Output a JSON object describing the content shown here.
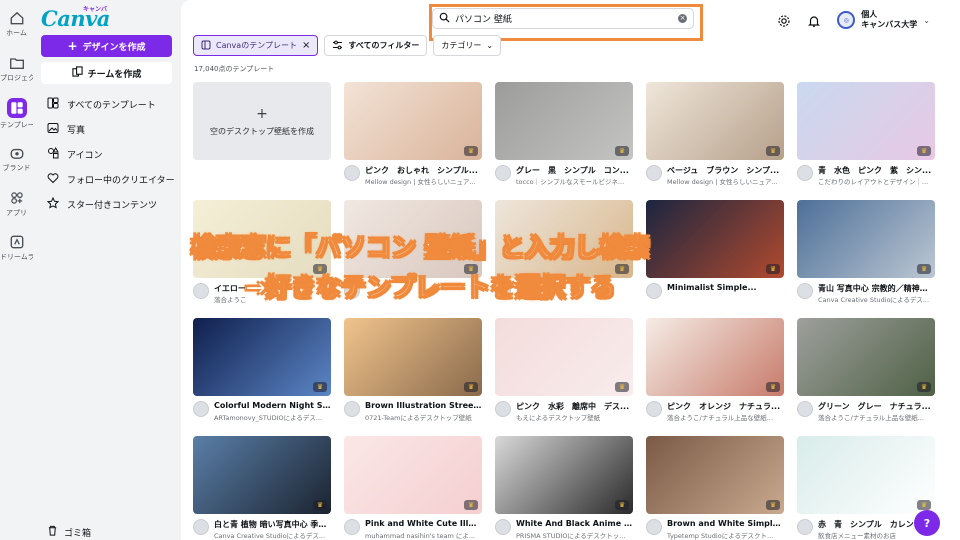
{
  "rail": [
    {
      "label": "ホーム",
      "icon": "home-icon"
    },
    {
      "label": "プロジェクト",
      "icon": "folder-icon"
    },
    {
      "label": "テンプレート",
      "icon": "templates-icon",
      "active": true
    },
    {
      "label": "ブランド",
      "icon": "brand-icon"
    },
    {
      "label": "アプリ",
      "icon": "apps-icon"
    },
    {
      "label": "ドリームラボ",
      "icon": "dreamlab-icon"
    }
  ],
  "logo": {
    "text": "Canva",
    "kana": "キャンバ"
  },
  "panel": {
    "create_label": "デザインを作成",
    "team_label": "チームを作成",
    "menu": [
      {
        "label": "すべてのテンプレート",
        "icon": "grid-icon"
      },
      {
        "label": "写真",
        "icon": "photo-icon"
      },
      {
        "label": "アイコン",
        "icon": "shapes-icon"
      },
      {
        "label": "フォロー中のクリエイター",
        "icon": "heart-icon"
      },
      {
        "label": "スター付きコンテンツ",
        "icon": "star-icon"
      }
    ],
    "trash_label": "ゴミ箱"
  },
  "search": {
    "value": "パソコン 壁紙"
  },
  "account": {
    "line1": "個人",
    "line2": "キャンバス大学"
  },
  "filters": {
    "selected_chip": "Canvaのテンプレート",
    "all_filters": "すべてのフィルター",
    "category": "カテゴリー"
  },
  "count_text": "17,040点のテンプレート",
  "blank_card": {
    "label": "空のデスクトップ壁紙を作成"
  },
  "cards": [
    {
      "title": "ピンク　おしゃれ　シンプル...",
      "sub": "Mellow design | 女性らしいニュア...",
      "colors": [
        "#f3e3d6",
        "#d9b39a"
      ]
    },
    {
      "title": "グレー　黒　シンプル　コン...",
      "sub": "tocco｜シンプルなスモールビジネ...",
      "colors": [
        "#9c9c9a",
        "#c4c4c2"
      ]
    },
    {
      "title": "ベージュ　ブラウン　シンプ...",
      "sub": "Mellow design | 女性らしいニュア...",
      "colors": [
        "#efe6da",
        "#b6a08a"
      ]
    },
    {
      "title": "青　水色　ピンク　紫　シン...",
      "sub": "こだわりのレイアウトとデザイン｜...",
      "colors": [
        "#c9d9f0",
        "#e8c8e4"
      ]
    },
    {
      "title": "イエロー",
      "sub": "落合ようこ",
      "colors": [
        "#f4efd6",
        "#e5dcc0"
      ]
    },
    {
      "title": "",
      "sub": "",
      "colors": [
        "#f1e8e2",
        "#d8c7bd"
      ]
    },
    {
      "title": "",
      "sub": "",
      "colors": [
        "#eee6dc",
        "#d9b68a"
      ]
    },
    {
      "title": "Minimalist Simple...",
      "sub": "",
      "colors": [
        "#1b2540",
        "#b14a2e"
      ]
    },
    {
      "title": "青山 写真中心 宗教的／精神的...",
      "sub": "Canva Creative Studioによるデス...",
      "colors": [
        "#4d6f98",
        "#bcc7d3"
      ]
    },
    {
      "title": "Colorful Modern Night Sky ...",
      "sub": "ARTamonovy_STUDIOによるデス...",
      "colors": [
        "#0f1f4d",
        "#5c86c6"
      ]
    },
    {
      "title": "Brown Illustration Street De...",
      "sub": "0721-Teamによるデスクトップ壁紙",
      "colors": [
        "#f1c48c",
        "#8a6a4c"
      ]
    },
    {
      "title": "ピンク　水彩　離席中　デス...",
      "sub": "もえによるデスクトップ壁紙",
      "colors": [
        "#f4dcdc",
        "#f8ecec"
      ]
    },
    {
      "title": "ピンク　オレンジ　ナチュラ...",
      "sub": "落合ようこ/ナチュラル上品な壁紙...",
      "colors": [
        "#f5ece6",
        "#c77b6a"
      ]
    },
    {
      "title": "グリーン　グレー　ナチュラ...",
      "sub": "落合ようこ/ナチュラル上品な壁紙...",
      "colors": [
        "#9ea09c",
        "#4f6146"
      ]
    },
    {
      "title": "白と青 植物 暗い写真中心 季節...",
      "sub": "Canva Creative Studioによるデス...",
      "colors": [
        "#5a7fa8",
        "#1b2330"
      ]
    },
    {
      "title": "Pink and White Cute Illustrat...",
      "sub": "muhammad nasihin's team によ...",
      "colors": [
        "#fbe7e7",
        "#f5cfd0"
      ]
    },
    {
      "title": "White And Black Anime Desk...",
      "sub": "PRISMA STUDIOによるデスクトッ...",
      "colors": [
        "#d9d9d9",
        "#2a2a2a"
      ]
    },
    {
      "title": "Brown and White Simple Blo...",
      "sub": "Typetemp Studioによるデスクト...",
      "colors": [
        "#7a5a46",
        "#c9a98e"
      ]
    },
    {
      "title": "赤　青　シンプル　カレン...",
      "sub": "飲食店メニュー素材のお店",
      "colors": [
        "#d8ecea",
        "#ffffff"
      ]
    }
  ],
  "overlay": {
    "line1": "検索窓に「パソコン 壁紙」と入力し検索",
    "line2": "→好きなテンプレートを選択する",
    "stroke_color": "#f08a3c"
  },
  "help_label": "?"
}
